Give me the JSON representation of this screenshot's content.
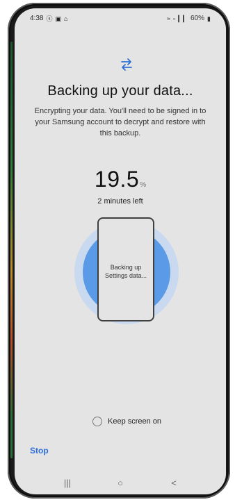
{
  "status_bar": {
    "time": "4:38",
    "left_icons": [
      "signal-s-icon",
      "gallery-icon",
      "lock-icon"
    ],
    "right_text": "60%",
    "right_icons": [
      "wifi-icon",
      "volte-icon",
      "signal-bars-icon",
      "battery-icon"
    ]
  },
  "header": {
    "icon": "transfer-arrows-icon",
    "title": "Backing up your data...",
    "subtitle": "Encrypting your data. You'll need to be signed in to your Samsung account to decrypt and restore with this backup."
  },
  "progress": {
    "value": "19.5",
    "unit": "%",
    "percent": 19.5,
    "time_left": "2 minutes left"
  },
  "phone_card": {
    "line1": "Backing up",
    "line2": "Settings data..."
  },
  "options": {
    "keep_screen_on": "Keep screen on",
    "keep_screen_on_checked": false
  },
  "actions": {
    "stop": "Stop"
  },
  "nav": {
    "recents": "|||",
    "home": "○",
    "back": "<"
  },
  "colors": {
    "accent": "#2f6fd6",
    "ring_light": "#c9d9ef",
    "ring_dark": "#5a9ae6",
    "screen_bg": "#e4e4e4"
  }
}
